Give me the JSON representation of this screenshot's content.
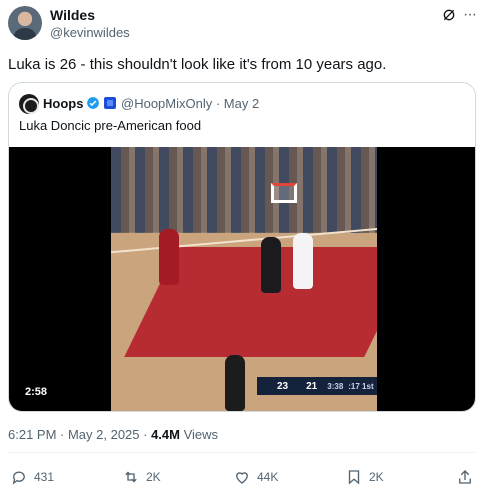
{
  "author": {
    "name": "Wildes",
    "handle": "@kevinwildes"
  },
  "header_icons": {
    "grok": "grok-icon",
    "more": "···"
  },
  "tweet_text": "Luka is 26 - this shouldn't look like it's from 10 years ago.",
  "quote": {
    "name": "Hoops",
    "handle_date": "@HoopMixOnly · May 2",
    "text": "Luka Doncic pre-American food",
    "video": {
      "duration": "2:58",
      "scoreboard": {
        "dal": "23",
        "hou": "21",
        "clock": "3:38",
        "period": ":17 1st"
      }
    }
  },
  "meta": {
    "time_date": "6:21 PM · May 2, 2025 · ",
    "views_value": "4.4M",
    "views_label": " Views"
  },
  "actions": {
    "replies": "431",
    "reposts": "2K",
    "likes": "44K",
    "bookmarks": "2K"
  },
  "colors": {
    "text": "#0f1419",
    "muted": "#536471",
    "verified": "#1d9bf0",
    "border": "#cfd9de"
  }
}
